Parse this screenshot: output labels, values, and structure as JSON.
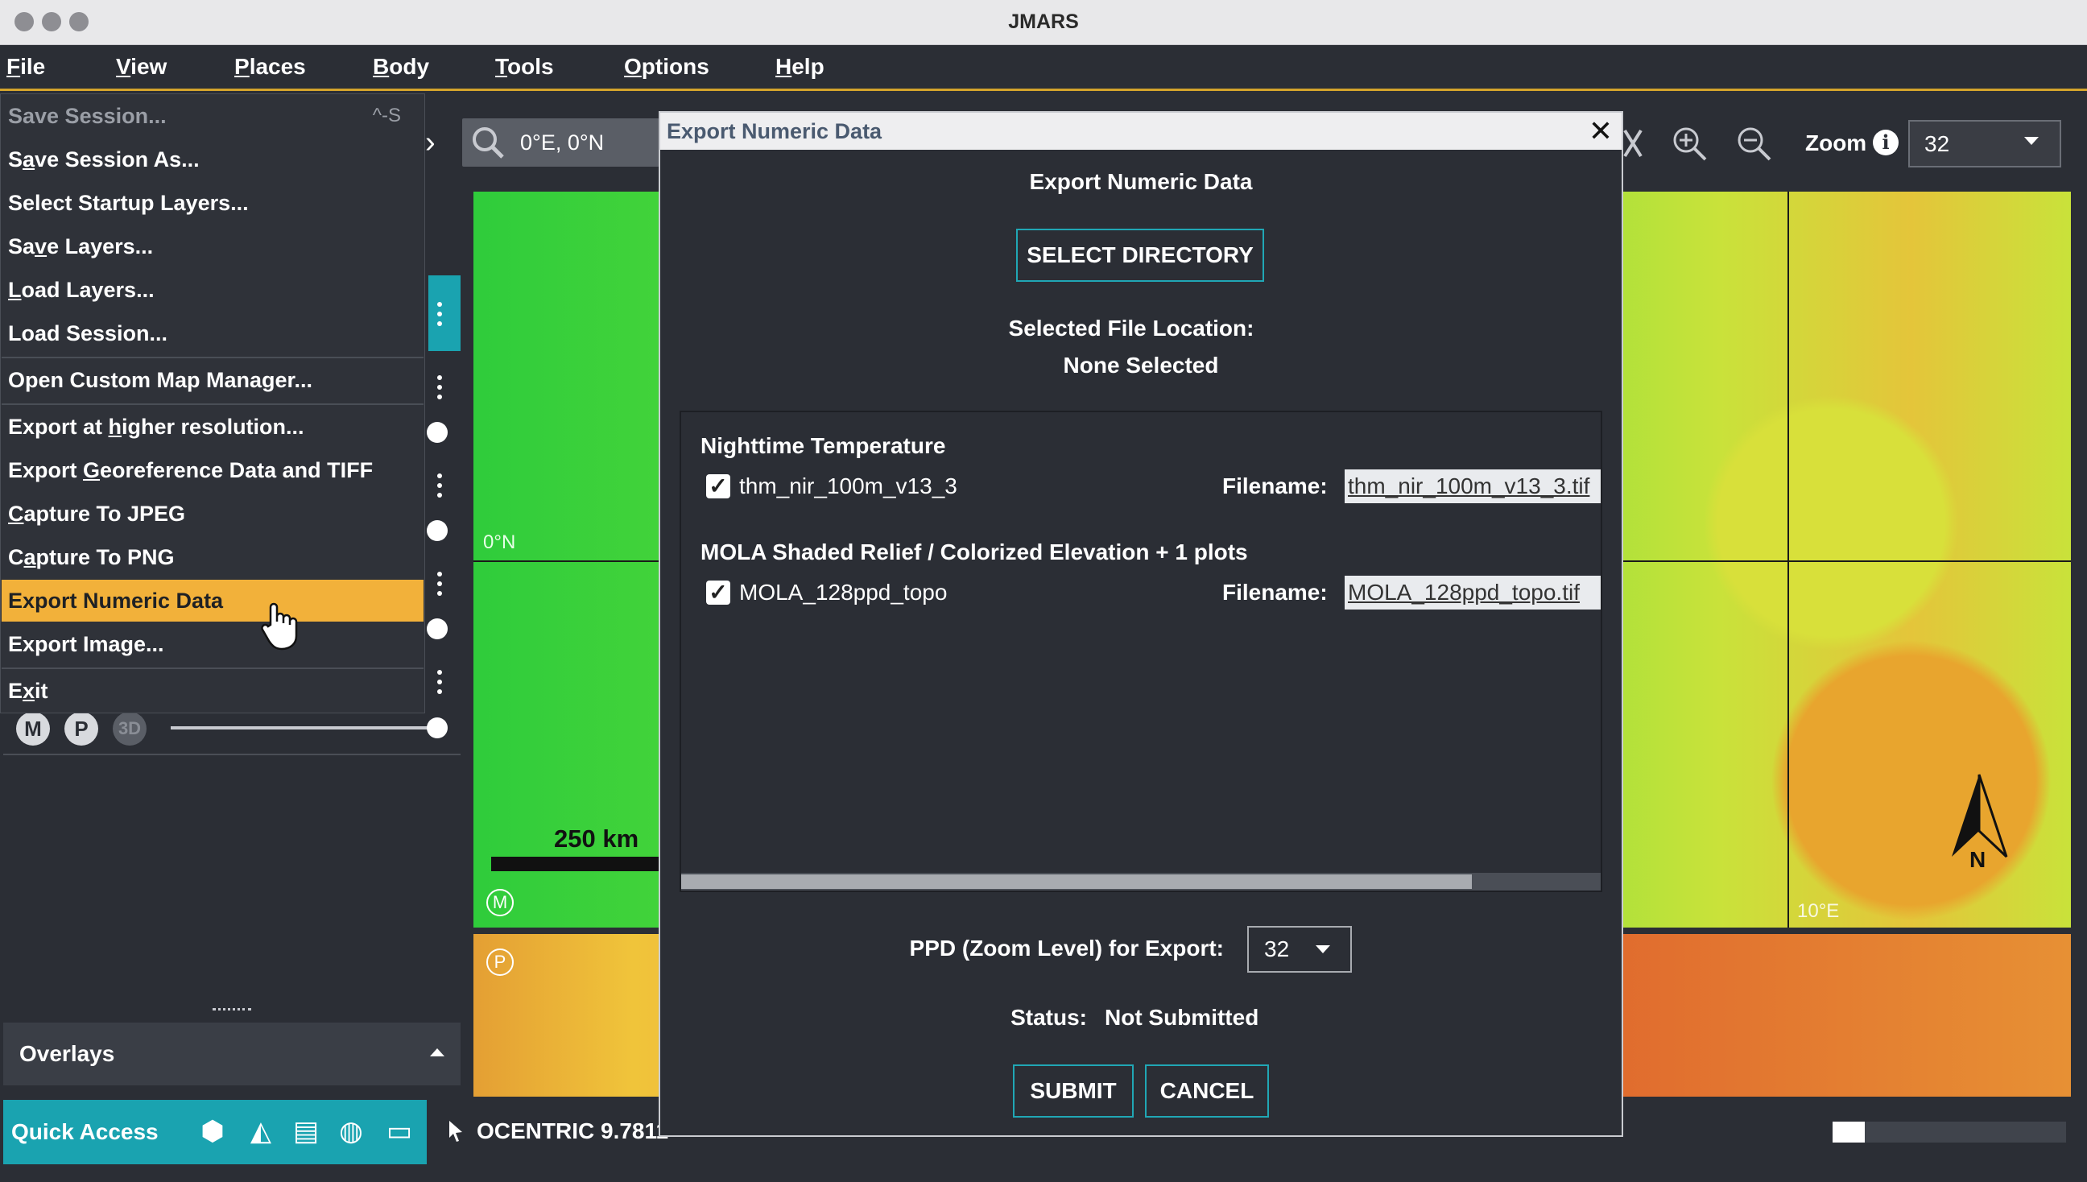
{
  "window": {
    "title": "JMARS"
  },
  "menubar": [
    {
      "label": "File",
      "u": "F",
      "rest": "ile"
    },
    {
      "label": "View",
      "u": "V",
      "rest": "iew"
    },
    {
      "label": "Places",
      "u": "P",
      "rest": "laces"
    },
    {
      "label": "Body",
      "u": "B",
      "rest": "ody"
    },
    {
      "label": "Tools",
      "u": "T",
      "rest": "ools"
    },
    {
      "label": "Options",
      "u": "O",
      "rest": "ptions"
    },
    {
      "label": "Help",
      "u": "H",
      "rest": "elp"
    }
  ],
  "toolbar": {
    "search_value": "0°E, 0°N",
    "zoom_label": "Zoom",
    "zoom_value": "32"
  },
  "file_menu": {
    "items": [
      {
        "pre": "",
        "u": "",
        "post": "Save Session...",
        "shortcut": "^-S",
        "disabled": true
      },
      {
        "pre": "S",
        "u": "a",
        "post": "ve Session As..."
      },
      {
        "pre": "",
        "u": "",
        "post": "Select Startup Layers..."
      },
      {
        "pre": "Sa",
        "u": "v",
        "post": "e Layers..."
      },
      {
        "pre": "",
        "u": "L",
        "post": "oad Layers..."
      },
      {
        "pre": "",
        "u": "",
        "post": "Load Session..."
      },
      {
        "pre": "",
        "u": "",
        "post": "Open Custom Map Manager..."
      },
      {
        "pre": "Export at ",
        "u": "h",
        "post": "igher resolution..."
      },
      {
        "pre": "Export ",
        "u": "G",
        "post": "eoreference Data and TIFF"
      },
      {
        "pre": "",
        "u": "C",
        "post": "apture To JPEG"
      },
      {
        "pre": "C",
        "u": "a",
        "post": "pture To PNG"
      },
      {
        "pre": "",
        "u": "",
        "post": "Export Numeric Data",
        "active": true
      },
      {
        "pre": "",
        "u": "",
        "post": "Export Image..."
      },
      {
        "pre": "E",
        "u": "x",
        "post": "it"
      }
    ]
  },
  "map": {
    "lat_label": "0°N",
    "lon_label": "10°E",
    "scale_label": "250 km",
    "north_label": "N",
    "m_badge": "M",
    "p_badge": "P"
  },
  "left_panel": {
    "mode_buttons": [
      "M",
      "P",
      "3D"
    ],
    "overlays_label": "Overlays",
    "quick_access_label": "Quick Access"
  },
  "status": {
    "coord_text": "OCENTRIC  9.7811"
  },
  "dialog": {
    "title": "Export Numeric Data",
    "heading": "Export Numeric Data",
    "select_dir_label": "SELECT DIRECTORY",
    "file_location_label": "Selected File Location:",
    "file_location_value": "None Selected",
    "layers": [
      {
        "heading": "Nighttime Temperature",
        "name": "thm_nir_100m_v13_3",
        "filename_label": "Filename:",
        "filename": "thm_nir_100m_v13_3.tif",
        "checked": true
      },
      {
        "heading": "MOLA Shaded Relief / Colorized Elevation + 1 plots",
        "name": "MOLA_128ppd_topo",
        "filename_label": "Filename:",
        "filename": "MOLA_128ppd_topo.tif",
        "checked": true
      }
    ],
    "scroll_fraction": 0.86,
    "ppd_label": "PPD (Zoom Level) for Export:",
    "ppd_value": "32",
    "status_label": "Status:",
    "status_value": "Not Submitted",
    "submit_label": "SUBMIT",
    "cancel_label": "CANCEL"
  }
}
